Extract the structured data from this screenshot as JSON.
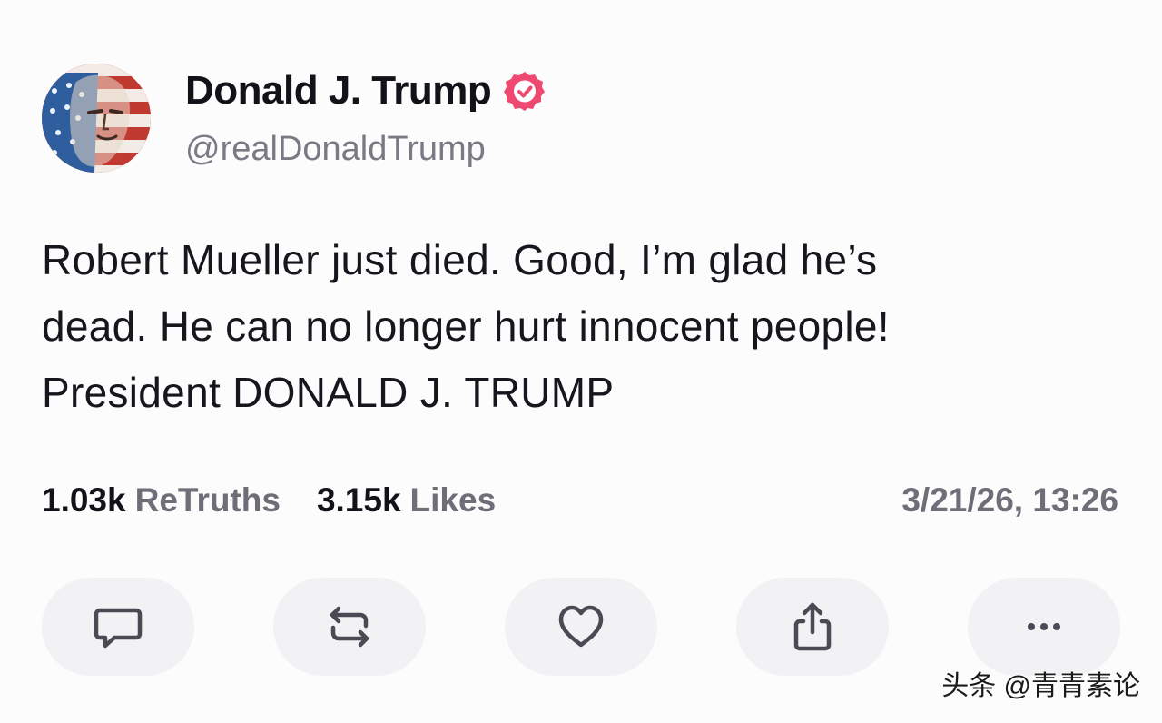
{
  "author": {
    "display_name": "Donald J. Trump",
    "handle": "@realDonaldTrump",
    "verified_icon": "verified-badge-icon",
    "verified_color": "#ee4a71"
  },
  "post": {
    "lines": [
      "Robert Mueller just died. Good, I’m glad he’s",
      "dead. He can no longer hurt innocent people!",
      "President DONALD J. TRUMP"
    ]
  },
  "stats": {
    "retruths_count": "1.03k",
    "retruths_label": "ReTruths",
    "likes_count": "3.15k",
    "likes_label": "Likes",
    "timestamp": "3/21/26, 13:26"
  },
  "actions": [
    {
      "name": "reply",
      "icon": "comment-icon"
    },
    {
      "name": "retruth",
      "icon": "repost-icon"
    },
    {
      "name": "like",
      "icon": "heart-icon"
    },
    {
      "name": "share",
      "icon": "share-icon"
    },
    {
      "name": "more",
      "icon": "more-dots-icon"
    }
  ],
  "watermark": "头条 @青青素论",
  "colors": {
    "background": "#fcfcfd",
    "action_bg": "#f2f2f5",
    "muted_text": "#6e6e78",
    "icon_stroke": "#4a4a55"
  }
}
